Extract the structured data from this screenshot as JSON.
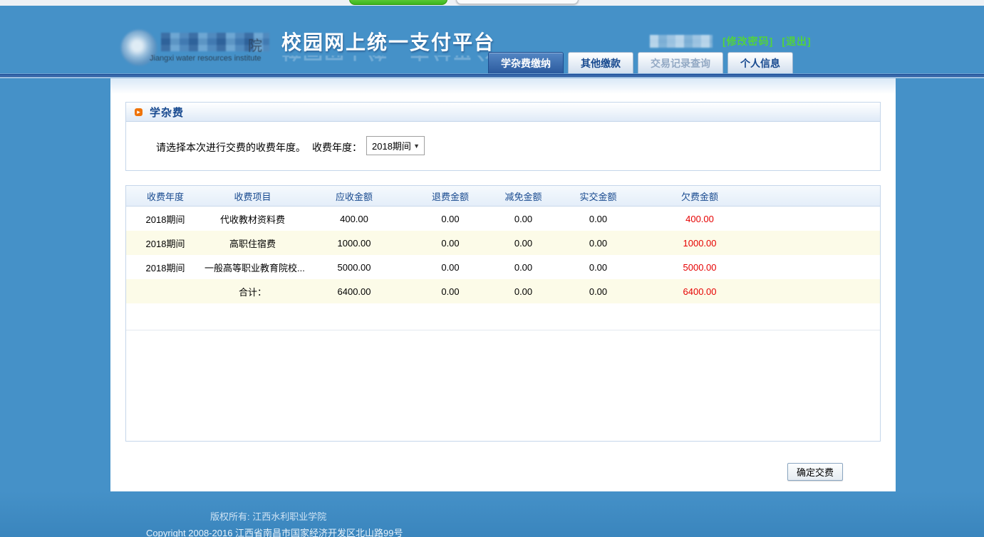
{
  "header": {
    "title": "校园网上统一支付平台",
    "logo": {
      "suffix": "院",
      "subtitle": "Jiangxi water resources institute"
    },
    "user": {
      "change_password": "[修改密码]",
      "logout": "[退出]"
    }
  },
  "nav": {
    "tabs": [
      {
        "id": "tuition",
        "label": "学杂费缴纳",
        "state": "active"
      },
      {
        "id": "other",
        "label": "其他缴款",
        "state": "normal"
      },
      {
        "id": "records",
        "label": "交易记录查询",
        "state": "disabled"
      },
      {
        "id": "profile",
        "label": "个人信息",
        "state": "normal"
      }
    ]
  },
  "section": {
    "title": "学杂费",
    "instruction": "请选择本次进行交费的收费年度。",
    "year_field": {
      "label": "收费年度：",
      "value": "2018期间"
    }
  },
  "fee_table": {
    "headers": [
      "收费年度",
      "收费项目",
      "应收金额",
      "退费金额",
      "减免金额",
      "实交金额",
      "欠费金额"
    ],
    "rows": [
      {
        "cells": [
          "2018期间",
          "代收教材资料费",
          "400.00",
          "0.00",
          "0.00",
          "0.00",
          "400.00"
        ],
        "highlight": false
      },
      {
        "cells": [
          "2018期间",
          "高职住宿费",
          "1000.00",
          "0.00",
          "0.00",
          "0.00",
          "1000.00"
        ],
        "highlight": true
      },
      {
        "cells": [
          "2018期间",
          "一般高等职业教育院校...",
          "5000.00",
          "0.00",
          "0.00",
          "0.00",
          "5000.00"
        ],
        "highlight": false
      },
      {
        "cells": [
          "",
          "合计：",
          "6400.00",
          "0.00",
          "0.00",
          "0.00",
          "6400.00"
        ],
        "highlight": true
      }
    ]
  },
  "actions": {
    "confirm_label": "确定交费"
  },
  "footer": {
    "copyright_line1": "版权所有: 江西水利职业学院",
    "copyright_line2": "Copyright 2008-2016 江西省南昌市国家经济开发区北山路99号"
  },
  "colors": {
    "page_blue": "#4591c8",
    "accent_dark_blue": "#17498f",
    "active_tab_blue": "#2b5a9e",
    "link_green": "#52d33c",
    "debt_red": "#e60000",
    "row_highlight_yellow": "#fcfbe8",
    "section_icon_orange": "#ef7308"
  }
}
